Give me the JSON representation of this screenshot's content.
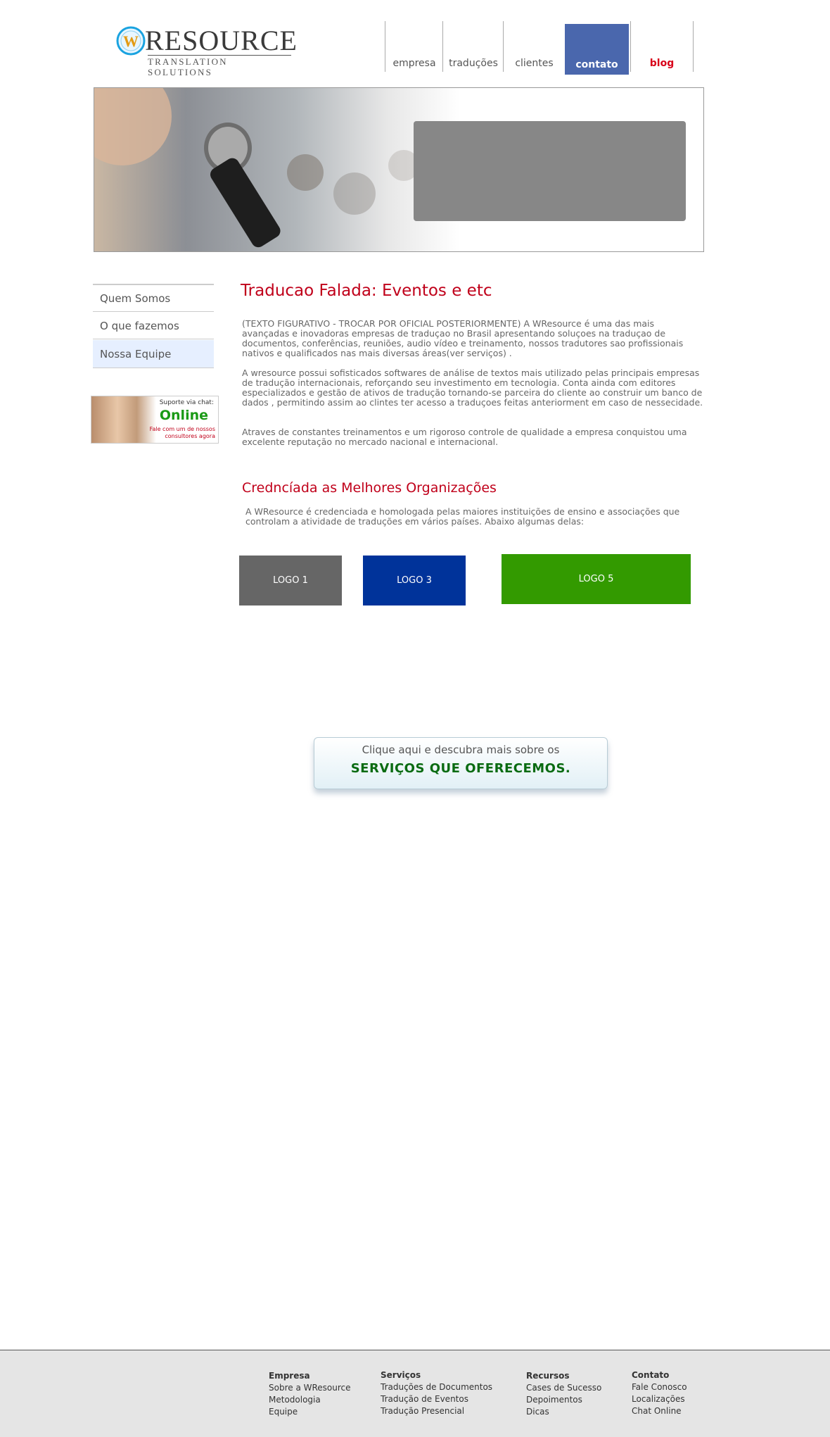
{
  "logo": {
    "mark": "W",
    "brand": "RESOURCE",
    "tagline": "TRANSLATION SOLUTIONS"
  },
  "nav": [
    {
      "label": "empresa"
    },
    {
      "label": "traduções"
    },
    {
      "label": "clientes"
    },
    {
      "label": "contato"
    },
    {
      "label": "blog"
    }
  ],
  "sidebar": {
    "items": [
      {
        "label": "Quem Somos"
      },
      {
        "label": "O que fazemos"
      },
      {
        "label": "Nossa Equipe"
      }
    ],
    "chat": {
      "label": "Suporte via chat:",
      "status": "Online",
      "sub": "Fale com um de nossos consultores agora"
    }
  },
  "main": {
    "title": "Traducao Falada: Eventos e etc",
    "paragraphs": [
      "(TEXTO FIGURATIVO - TROCAR POR OFICIAL POSTERIORMENTE) A WResource  é uma das mais avançadas e inovadoras empresas de traduçao  no Brasil apresentando soluçoes  na  traduçao de documentos, conferências, reuniões, audio vídeo e treinamento, nossos tradutores sao profissionais nativos e  qualificados nas mais diversas áreas(ver serviços) .",
      "A wresource possui sofisticados  softwares de análise de textos mais utilizado pelas principais empresas de tradução internacionais, reforçando seu investimento em tecnologia. Conta ainda com editores especializados e gestão de ativos de tradução tornando-se parceira do cliente ao construir um banco de dados , permitindo  assim ao clintes ter acesso a traduçoes feitas anteriorment em caso de nessecidade.",
      "Atraves de constantes treinamentos e um rigoroso controle de qualidade a empresa conquistou uma excelente  reputação  no mercado nacional e internacional."
    ],
    "subtitle": "Credncíada as Melhores Organizações",
    "sub_paragraph": "A WResource  é credenciada e homologada pelas maiores instituições de ensino e associações que controlam a atividade de traduções em vários países. Abaixo algumas delas:",
    "logos": [
      {
        "label": "LOGO 1",
        "color": "#666666"
      },
      {
        "label": "LOGO 3",
        "color": "#00339a"
      },
      {
        "label": "LOGO 5",
        "color": "#339a00"
      }
    ]
  },
  "cta": {
    "line1": "Clique aqui e descubra mais sobre os",
    "line2": "SERVIÇOS QUE OFERECEMOS."
  },
  "footer": {
    "columns": [
      {
        "heading": "Empresa",
        "links": [
          "Sobre a WResource",
          "Metodologia",
          "Equipe"
        ]
      },
      {
        "heading": "Serviços",
        "links": [
          "Traduções de Documentos",
          "Tradução de Eventos",
          "Tradução Presencial"
        ]
      },
      {
        "heading": "Recursos",
        "links": [
          "Cases de Sucesso",
          "Depoimentos",
          "Dicas"
        ]
      },
      {
        "heading": "Contato",
        "links": [
          "Fale Conosco",
          "Localizações",
          "Chat Online"
        ]
      }
    ]
  },
  "colors": {
    "accent_red": "#c0001a",
    "nav_active": "#4a67ad",
    "cta_green": "#0a6b12"
  }
}
